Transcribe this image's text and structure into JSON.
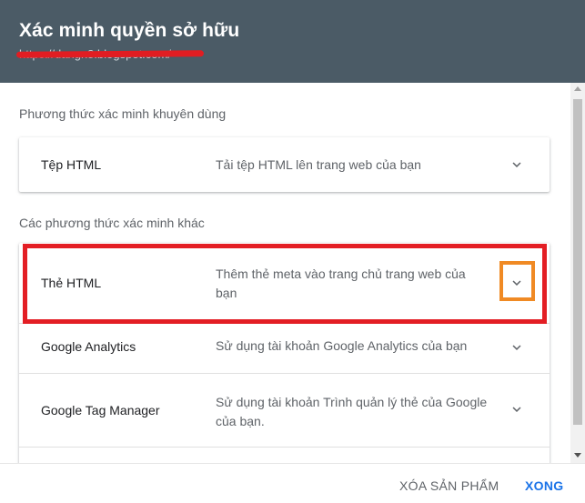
{
  "header": {
    "title": "Xác minh quyền sở hữu",
    "url": "https://dangn8.blogspot.com/"
  },
  "recommended": {
    "label": "Phương thức xác minh khuyên dùng",
    "items": [
      {
        "name": "Tệp HTML",
        "desc": "Tải tệp HTML lên trang web của bạn"
      }
    ]
  },
  "other": {
    "label": "Các phương thức xác minh khác",
    "items": [
      {
        "name": "Thẻ HTML",
        "desc": "Thêm thẻ meta vào trang chủ trang web của bạn"
      },
      {
        "name": "Google Analytics",
        "desc": "Sử dụng tài khoản Google Analytics của bạn"
      },
      {
        "name": "Google Tag Manager",
        "desc": "Sử dụng tài khoản Trình quản lý thẻ của Google của bạn."
      }
    ]
  },
  "footer": {
    "remove_label": "XÓA SẢN PHẨM",
    "done_label": "XONG"
  },
  "colors": {
    "header_bg": "#4b5b66",
    "accent": "#1a73e8",
    "highlight_red": "#e31e24",
    "highlight_orange": "#f08a24"
  },
  "icons": {
    "expand": "chevron-down-icon"
  }
}
